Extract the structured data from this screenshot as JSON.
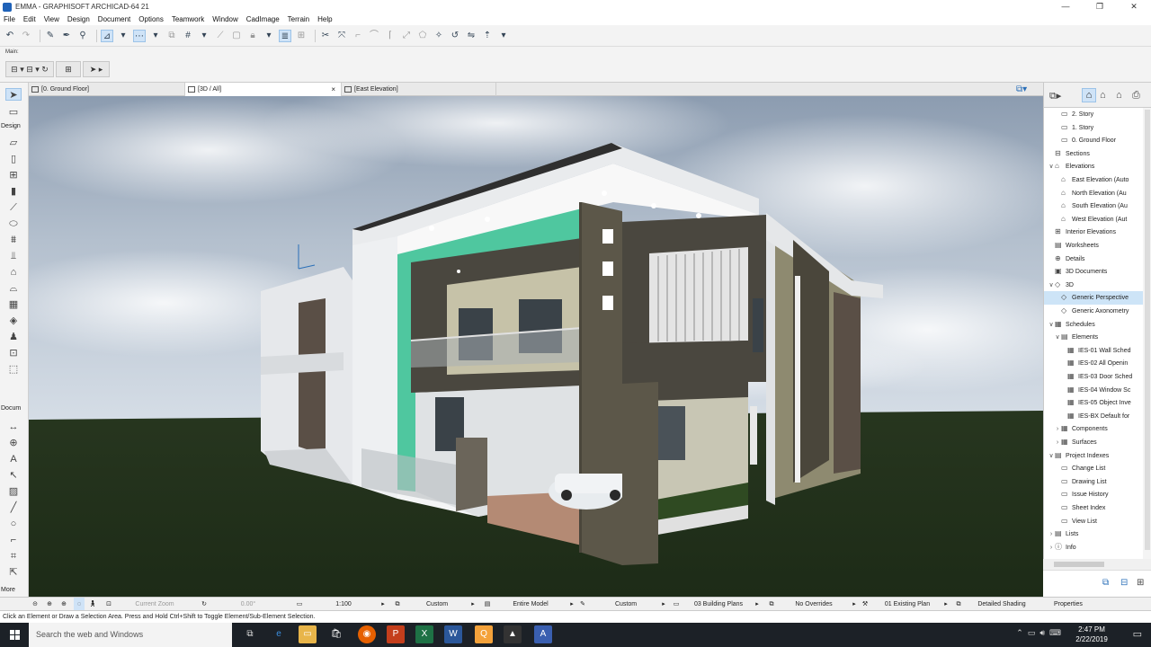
{
  "window": {
    "title": "EMMA - GRAPHISOFT ARCHICAD-64 21",
    "buttons": [
      "—",
      "❐",
      "✕"
    ]
  },
  "menu": [
    "File",
    "Edit",
    "View",
    "Design",
    "Document",
    "Options",
    "Teamwork",
    "Window",
    "CadImage",
    "Terrain",
    "Help"
  ],
  "infobox": {
    "label": "Main:"
  },
  "tabs": [
    {
      "label": "[0. Ground Floor]"
    },
    {
      "label": "[3D / All]",
      "close": "×"
    },
    {
      "label": "[East Elevation]"
    }
  ],
  "toolbox": {
    "design_header": "Design",
    "document_header": "Docum",
    "more_label": "More"
  },
  "navigator": {
    "items": [
      {
        "label": "2. Story",
        "icon": "story-icon",
        "indent": 2
      },
      {
        "label": "1. Story",
        "icon": "story-icon",
        "indent": 2
      },
      {
        "label": "0. Ground Floor",
        "icon": "story-icon",
        "indent": 2
      },
      {
        "label": "Sections",
        "icon": "section-icon",
        "indent": 1
      },
      {
        "label": "Elevations",
        "icon": "elevation-icon",
        "indent": 1,
        "tw": "∨"
      },
      {
        "label": "East Elevation (Auto",
        "icon": "elevation-icon",
        "indent": 2
      },
      {
        "label": "North Elevation (Au",
        "icon": "elevation-icon",
        "indent": 2
      },
      {
        "label": "South Elevation (Au",
        "icon": "elevation-icon",
        "indent": 2
      },
      {
        "label": "West Elevation (Aut",
        "icon": "elevation-icon",
        "indent": 2
      },
      {
        "label": "Interior Elevations",
        "icon": "interior-elevation-icon",
        "indent": 1
      },
      {
        "label": "Worksheets",
        "icon": "worksheet-icon",
        "indent": 1
      },
      {
        "label": "Details",
        "icon": "detail-icon",
        "indent": 1
      },
      {
        "label": "3D Documents",
        "icon": "3d-document-icon",
        "indent": 1
      },
      {
        "label": "3D",
        "icon": "3d-icon",
        "indent": 1,
        "tw": "∨"
      },
      {
        "label": "Generic Perspective",
        "icon": "perspective-icon",
        "indent": 2,
        "selected": true
      },
      {
        "label": "Generic Axonometry",
        "icon": "axonometry-icon",
        "indent": 2
      },
      {
        "label": "Schedules",
        "icon": "schedule-icon",
        "indent": 1,
        "tw": "∨"
      },
      {
        "label": "Elements",
        "icon": "folder-icon",
        "indent": 2,
        "tw": "∨"
      },
      {
        "label": "IES-01 Wall Sched",
        "icon": "table-icon",
        "indent": 3
      },
      {
        "label": "IES-02 All Openin",
        "icon": "table-icon",
        "indent": 3
      },
      {
        "label": "IES-03 Door Sched",
        "icon": "table-icon",
        "indent": 3
      },
      {
        "label": "IES-04 Window Sc",
        "icon": "table-icon",
        "indent": 3
      },
      {
        "label": "IES-05 Object Inve",
        "icon": "table-icon",
        "indent": 3
      },
      {
        "label": "IES-BX Default for",
        "icon": "table-icon",
        "indent": 3
      },
      {
        "label": "Components",
        "icon": "component-icon",
        "indent": 2,
        "tw": "›"
      },
      {
        "label": "Surfaces",
        "icon": "surface-icon",
        "indent": 2,
        "tw": "›"
      },
      {
        "label": "Project Indexes",
        "icon": "index-icon",
        "indent": 1,
        "tw": "∨"
      },
      {
        "label": "Change List",
        "icon": "list-icon",
        "indent": 2
      },
      {
        "label": "Drawing List",
        "icon": "list-icon",
        "indent": 2
      },
      {
        "label": "Issue History",
        "icon": "list-icon",
        "indent": 2
      },
      {
        "label": "Sheet Index",
        "icon": "list-icon",
        "indent": 2
      },
      {
        "label": "View List",
        "icon": "list-icon",
        "indent": 2
      },
      {
        "label": "Lists",
        "icon": "lists-icon",
        "indent": 1,
        "tw": "›"
      },
      {
        "label": "Info",
        "icon": "info-icon",
        "indent": 1,
        "tw": "›"
      }
    ]
  },
  "statusbar": {
    "zoom_label": "Current Zoom",
    "angle": "0.00°",
    "scale": "1:100",
    "layer_combo": "Custom",
    "structure": "Entire Model",
    "pen_set": "Custom",
    "model_view": "03 Building Plans",
    "overrides": "No Overrides",
    "renovation": "01 Existing Plan",
    "shading": "Detailed Shading"
  },
  "properties_label": "Properties",
  "hint": "Click an Element or Draw a Selection Area. Press and Hold Ctrl+Shift to Toggle Element/Sub-Element Selection.",
  "taskbar": {
    "search_placeholder": "Search the web and Windows",
    "time": "2:47 PM",
    "date": "2/22/2019"
  },
  "colors": {
    "accent": "#1f62b8",
    "selection": "#cde4f7",
    "accent_wall": "#4fc79f",
    "taskbar": "#1c2127"
  }
}
